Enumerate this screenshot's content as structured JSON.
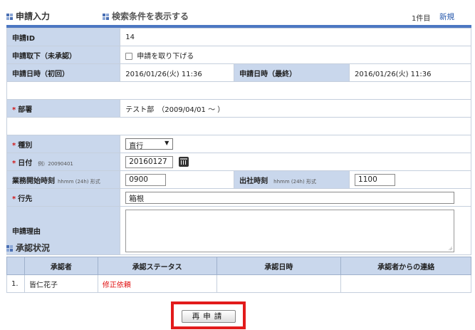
{
  "header": {
    "title": "申請入力",
    "search_toggle": "検索条件を表示する",
    "count": "1件目",
    "new_link": "新規"
  },
  "form": {
    "request_id": {
      "label": "申請ID",
      "value": "14"
    },
    "withdraw": {
      "label": "申請取下（未承認）",
      "checkbox_label": "申請を取り下げる"
    },
    "date_first": {
      "label": "申請日時（初回）",
      "value": "2016/01/26(火) 11:36"
    },
    "date_last": {
      "label": "申請日時（最終）",
      "value": "2016/01/26(火) 11:36"
    },
    "department": {
      "label": "部署",
      "value": "テスト部　（2009/04/01 ～ ）"
    },
    "type": {
      "label": "種別",
      "value": "直行"
    },
    "date": {
      "label": "日付",
      "hint": "例）20090401",
      "value": "20160127"
    },
    "start_time": {
      "label": "業務開始時刻",
      "hint": "hhmm (24h) 形式",
      "value": "0900"
    },
    "office_time": {
      "label": "出社時刻",
      "hint": "hhmm (24h) 形式",
      "value": "1100"
    },
    "destination": {
      "label": "行先",
      "value": "箱根"
    },
    "reason": {
      "label": "申請理由",
      "value": ""
    },
    "required_mark": "*"
  },
  "approval": {
    "title": "承認状況",
    "columns": [
      "承認者",
      "承認ステータス",
      "承認日時",
      "承認者からの連絡"
    ],
    "rows": [
      {
        "no": "1.",
        "approver": "皆仁花子",
        "status": "修正依頼",
        "date": "",
        "message": ""
      }
    ]
  },
  "resubmit_label": "再申請",
  "colors": {
    "accent": "#4c77c2",
    "label_bg": "#c9d7ec",
    "required": "#d01818",
    "highlight_border": "#e21b1b"
  }
}
